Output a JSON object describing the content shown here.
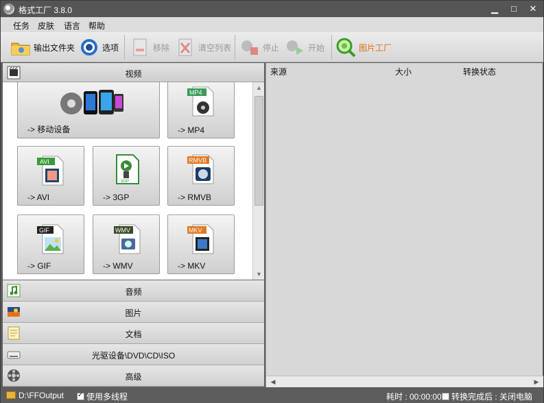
{
  "window": {
    "title": "格式工厂 3.8.0",
    "min": "▁",
    "max": "□",
    "close": "✕"
  },
  "menu": [
    "任务",
    "皮肤",
    "语言",
    "帮助"
  ],
  "toolbar": {
    "output_folder": "输出文件夹",
    "options": "选项",
    "remove": "移除",
    "clear_list": "清空列表",
    "stop": "停止",
    "start": "开始",
    "picture_factory": "图片工厂"
  },
  "categories": {
    "video": "视频",
    "audio": "音频",
    "image": "图片",
    "document": "文档",
    "rom": "光驱设备\\DVD\\CD\\ISO",
    "advanced": "高级"
  },
  "tiles": [
    {
      "label": "-> 移动设备",
      "badge": ""
    },
    {
      "label": "-> MP4",
      "badge": "MP4"
    },
    {
      "label": "-> AVI",
      "badge": "AVI"
    },
    {
      "label": "-> 3GP",
      "badge": "3GP"
    },
    {
      "label": "-> RMVB",
      "badge": "RMVB"
    },
    {
      "label": "-> GIF",
      "badge": "GIF"
    },
    {
      "label": "-> WMV",
      "badge": "WMV"
    },
    {
      "label": "-> MKV",
      "badge": "MKV"
    }
  ],
  "list_columns": {
    "source": "来源",
    "size": "大小",
    "status": "转换状态"
  },
  "statusbar": {
    "output_path": "D:\\FFOutput",
    "multithread": "使用多线程",
    "elapsed": "耗时 : 00:00:00",
    "after_done": "转换完成后 : 关闭电脑"
  },
  "colors": {
    "accent": "#e07010",
    "title_bg": "#555555"
  }
}
